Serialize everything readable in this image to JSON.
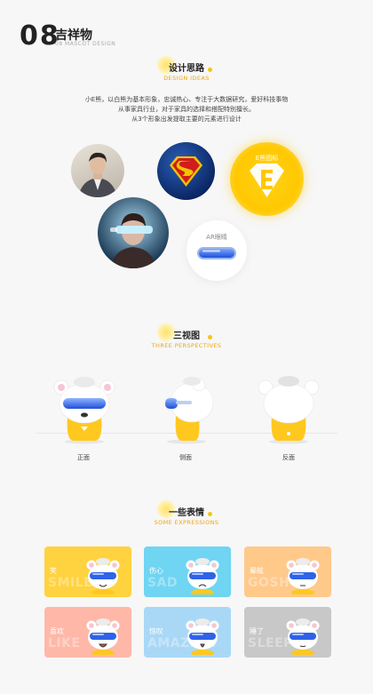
{
  "header": {
    "number": "08",
    "title": "吉祥物",
    "subtitle": "08 MASCOT DESIGN"
  },
  "design": {
    "title": "设计思路",
    "subtitle": "DESIGN IDEAS",
    "lines": [
      "小E熊，以白熊为基本形象，忠诚热心、专注于大数据研究，爱好科技事物",
      "从事家具行业，对于家具的选择和搭配特别擅长。",
      "从3个形象出发提取主要的元素进行设计"
    ],
    "logo_label": "E熊图标",
    "ar_label": "AR眼睛"
  },
  "views": {
    "title": "三视图",
    "subtitle": "THREE PERSPECTIVES",
    "labels": [
      "正面",
      "侧面",
      "反面"
    ]
  },
  "expressions": {
    "title": "一些表情",
    "subtitle": "SOME EXPRESSIONS",
    "cards": [
      {
        "label": "笑",
        "en": "SMILE",
        "color": "#ffd23f"
      },
      {
        "label": "伤心",
        "en": "SAD",
        "color": "#6fd5f2"
      },
      {
        "label": "晕眩",
        "en": "GOSH",
        "color": "#ffc98a"
      },
      {
        "label": "喜欢",
        "en": "LIKE",
        "color": "#ffb8a8"
      },
      {
        "label": "惊叹",
        "en": "AMAZING",
        "color": "#a9d8f7"
      },
      {
        "label": "睡了",
        "en": "SLEEP",
        "color": "#c8c8c8"
      }
    ]
  }
}
